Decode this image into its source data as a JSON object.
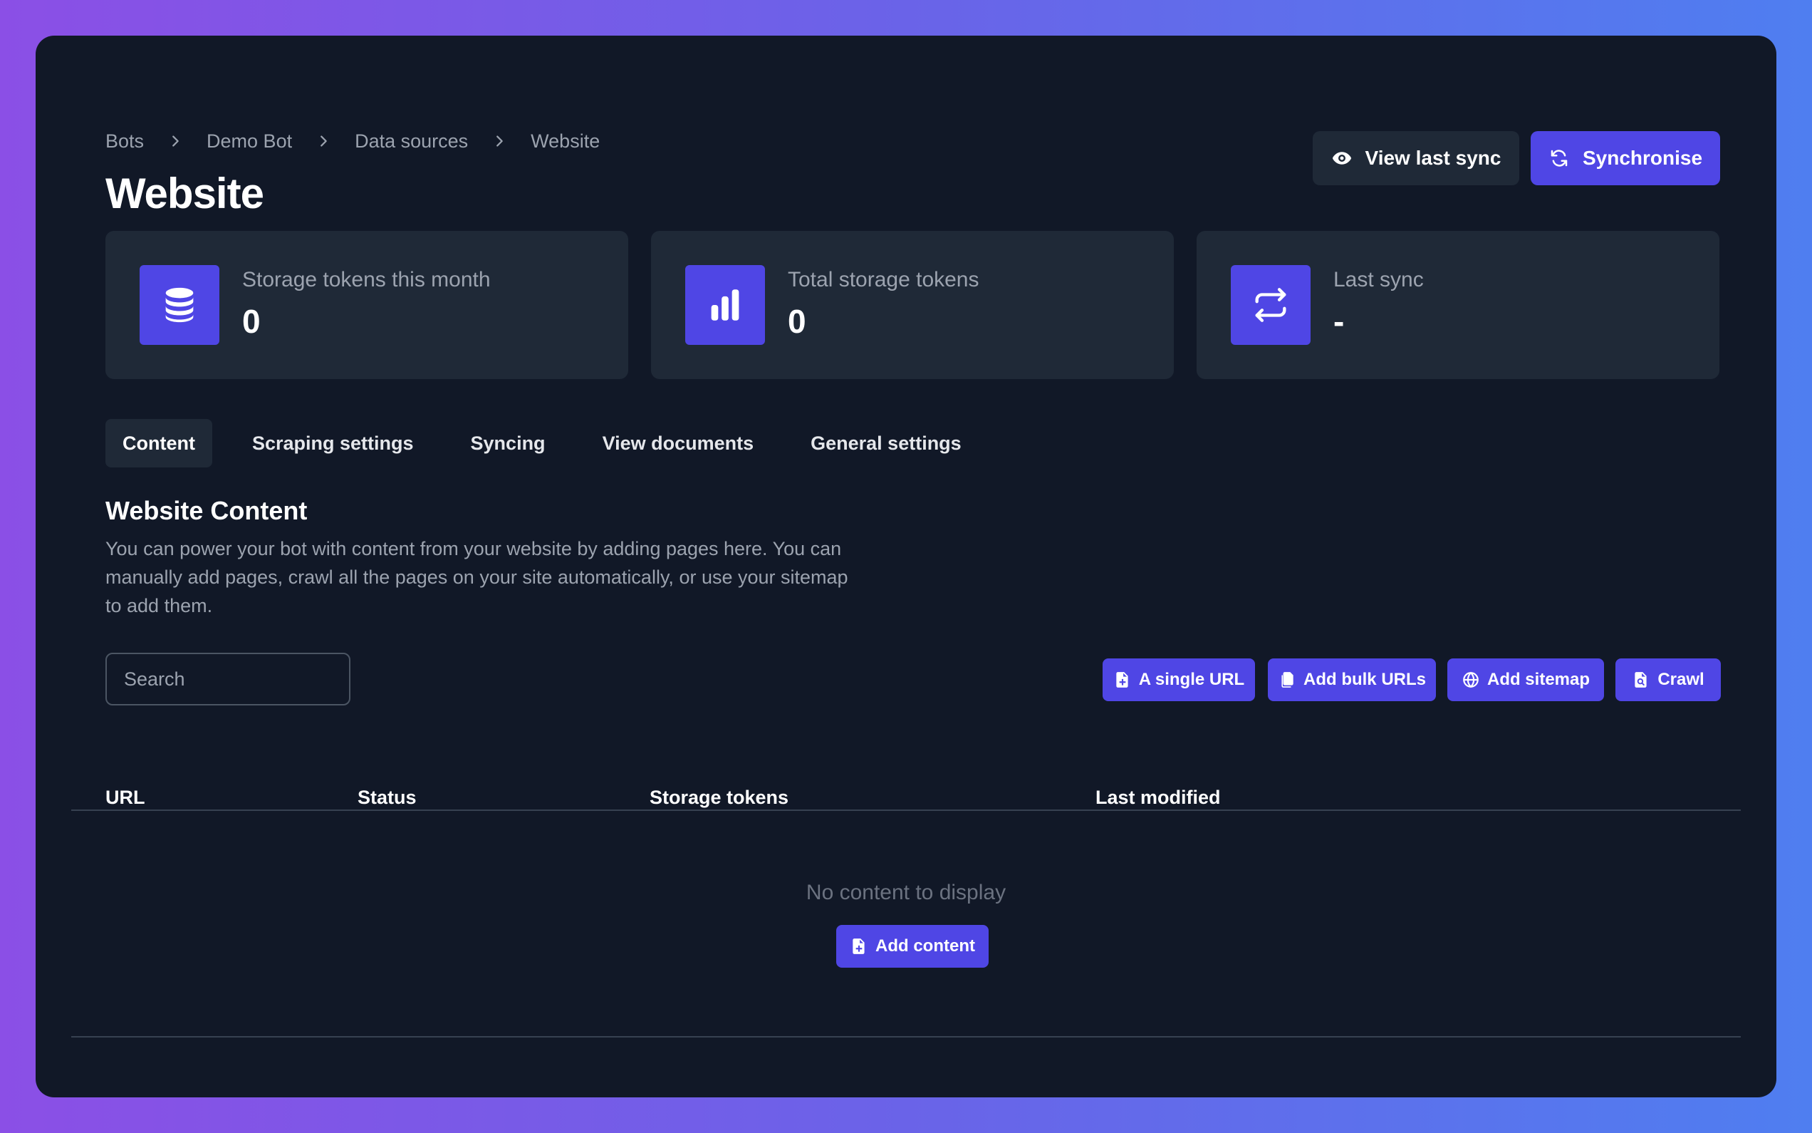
{
  "breadcrumb": [
    "Bots",
    "Demo Bot",
    "Data sources",
    "Website"
  ],
  "page": {
    "title": "Website"
  },
  "actions": {
    "view_last_sync": "View last sync",
    "synchronise": "Synchronise"
  },
  "stats": [
    {
      "label": "Storage tokens this month",
      "value": "0",
      "icon": "database-icon"
    },
    {
      "label": "Total storage tokens",
      "value": "0",
      "icon": "bar-chart-icon"
    },
    {
      "label": "Last sync",
      "value": "-",
      "icon": "sync-icon"
    }
  ],
  "tabs": [
    "Content",
    "Scraping settings",
    "Syncing",
    "View documents",
    "General settings"
  ],
  "active_tab": "Content",
  "content": {
    "title": "Website Content",
    "description": "You can power your bot with content from your website by adding pages here. You can manually add pages, crawl all the pages on your site automatically, or use your sitemap to add them.",
    "search_placeholder": "Search",
    "buttons": {
      "single_url": "A single URL",
      "bulk_urls": "Add bulk URLs",
      "sitemap": "Add sitemap",
      "crawl": "Crawl"
    }
  },
  "table": {
    "headers": [
      "URL",
      "Status",
      "Storage tokens",
      "Last modified"
    ],
    "empty_text": "No content to display",
    "add_content": "Add content"
  },
  "colors": {
    "accent": "#4f46e5",
    "surface": "#1f2937",
    "background": "#111827"
  }
}
